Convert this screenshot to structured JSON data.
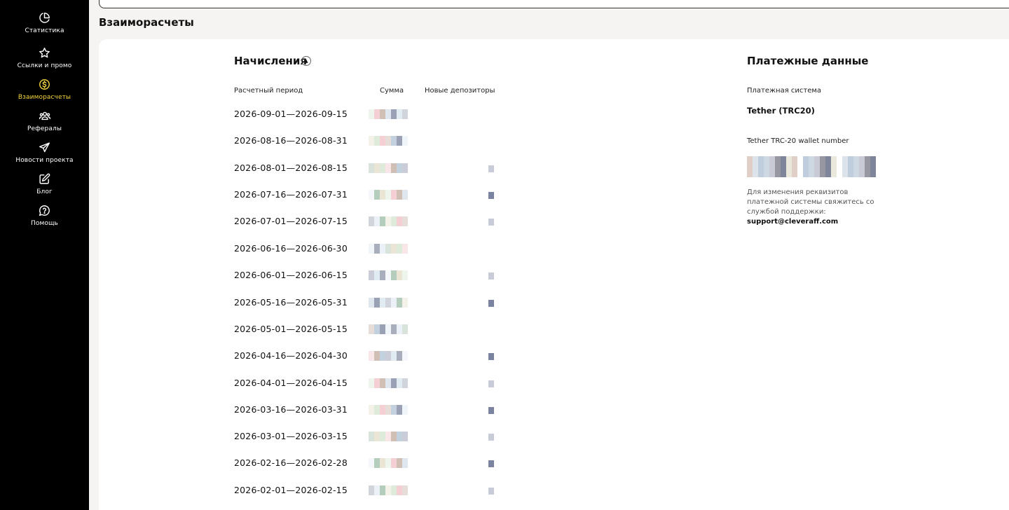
{
  "sidebar": {
    "items": [
      {
        "label": "Статистика",
        "icon": "pie-chart-icon",
        "active": false
      },
      {
        "label": "Ссылки и промо",
        "icon": "star-icon",
        "active": false
      },
      {
        "label": "Взаиморасчеты",
        "icon": "dollar-circle-icon",
        "active": true
      },
      {
        "label": "Рефералы",
        "icon": "users-icon",
        "active": false
      },
      {
        "label": "Новости проекта",
        "icon": "paper-plane-icon",
        "active": false
      },
      {
        "label": "Блог",
        "icon": "edit-icon",
        "active": false
      },
      {
        "label": "Помощь",
        "icon": "help-circle-icon",
        "active": false
      }
    ],
    "active_color": "#f4d43c"
  },
  "page": {
    "title": "Взаиморасчеты"
  },
  "accruals": {
    "title": "Начисления",
    "sort_icon": "triangle-up-icon",
    "columns": {
      "period": "Расчетный период",
      "amount": "Сумма",
      "depositors": "Новые депозиторы"
    },
    "rows": [
      "2026-09-01—2026-09-15",
      "2026-08-16—2026-08-31",
      "2026-08-01—2026-08-15",
      "2026-07-16—2026-07-31",
      "2026-07-01—2026-07-15",
      "2026-06-16—2026-06-30",
      "2026-06-01—2026-06-15",
      "2026-05-16—2026-05-31",
      "2026-05-01—2026-05-15",
      "2026-04-16—2026-04-30",
      "2026-04-01—2026-04-15",
      "2026-03-16—2026-03-31",
      "2026-03-01—2026-03-15",
      "2026-02-16—2026-02-28",
      "2026-02-01—2026-02-15"
    ]
  },
  "payment": {
    "title": "Платежные данные",
    "system_label": "Платежная система",
    "system_value": "Tether (TRC20)",
    "wallet_label": "Tether TRC-20 wallet number",
    "note_text": "Для изменения реквизитов платежной системы свяжитесь со службой поддержки:",
    "support_email": "support@cleveraff.com"
  }
}
